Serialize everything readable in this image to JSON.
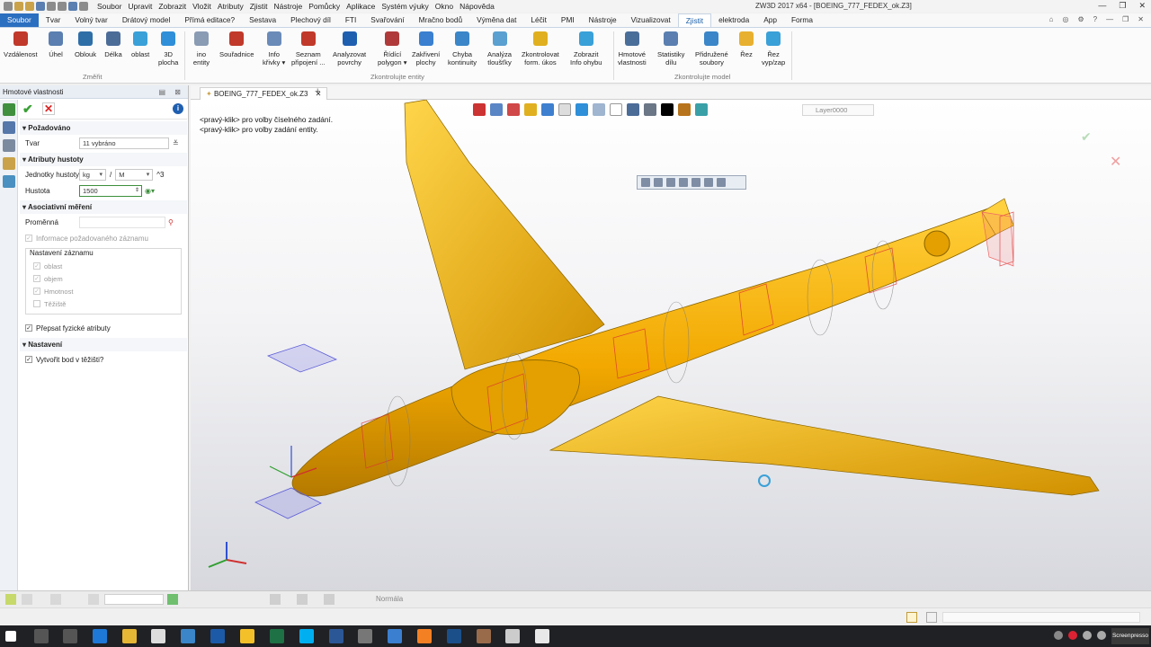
{
  "menu": [
    "Soubor",
    "Upravit",
    "Zobrazit",
    "Vložit",
    "Atributy",
    "Zjistit",
    "Nástroje",
    "Pomůcky",
    "Aplikace",
    "Systém výuky",
    "Okno",
    "Nápověda"
  ],
  "window_title": "ZW3D 2017 x64 - [BOEING_777_FEDEX_ok.Z3]",
  "ribbon_tabs": [
    "Soubor",
    "Tvar",
    "Volný tvar",
    "Drátový model",
    "Přímá editace?",
    "Sestava",
    "Plechový díl",
    "FTI",
    "Svařování",
    "Mračno bodů",
    "Výměna dat",
    "Léčit",
    "PMI",
    "Nástroje",
    "Vizualizovat",
    "Zjistit",
    "elektroda",
    "App",
    "Forma"
  ],
  "active_tab": "Zjistit",
  "ribbon": {
    "measure": [
      {
        "label": "Vzdálenost",
        "icon": "distance-icon"
      },
      {
        "label": "Úhel",
        "icon": "angle-icon"
      },
      {
        "label": "Oblouk",
        "icon": "arc-icon"
      },
      {
        "label": "Délka",
        "icon": "length-icon"
      },
      {
        "label": "oblast",
        "icon": "area-icon"
      },
      {
        "label": "3D\nplocha",
        "icon": "3d-surface-icon"
      }
    ],
    "measure_group": "Změřit",
    "check": [
      {
        "label": "ino\nentity",
        "icon": "info-entity-icon"
      },
      {
        "label": "Souřadnice",
        "icon": "coordinates-icon"
      },
      {
        "label": "Info\nkřivky ▾",
        "icon": "curve-info-icon"
      },
      {
        "label": "Seznam\npřipojení ...",
        "icon": "connection-list-icon"
      },
      {
        "label": "Analyzovat\npovrchy",
        "icon": "analyze-surface-icon"
      },
      {
        "label": "Řídící\npolygon ▾",
        "icon": "control-polygon-icon"
      },
      {
        "label": "Zakřivení\nplochy",
        "icon": "curvature-icon"
      },
      {
        "label": "Chyba\nkontinuity",
        "icon": "continuity-icon"
      },
      {
        "label": "Analýza\ntloušťky",
        "icon": "thickness-icon"
      },
      {
        "label": "Zkontrolovat\nform. úkos",
        "icon": "draft-check-icon"
      },
      {
        "label": "Zobrazit\nInfo ohybu",
        "icon": "bend-info-icon"
      }
    ],
    "check_group": "Zkontrolujte entity",
    "model": [
      {
        "label": "Hmotové\nvlastnosti",
        "icon": "mass-properties-icon"
      },
      {
        "label": "Statistiky\ndílu",
        "icon": "part-stats-icon"
      },
      {
        "label": "Přidružené\nsoubory",
        "icon": "related-files-icon"
      },
      {
        "label": "Řez",
        "icon": "section-icon"
      },
      {
        "label": "Řez\nvyp/zap",
        "icon": "section-toggle-icon"
      }
    ],
    "model_group": "Zkontrolujte model"
  },
  "panel": {
    "title": "Hmotové vlastnosti",
    "section_required": "Požadováno",
    "shape_label": "Tvar",
    "shape_value": "11 vybráno",
    "section_density": "Atributy hustoty",
    "density_units_label": "Jednotky hustoty",
    "unit_mass": "kg",
    "unit_sep": "/",
    "unit_length": "M",
    "unit_power": "^3",
    "density_label": "Hustota",
    "density_value": "1500",
    "section_assoc": "Asociativní měření",
    "variable_label": "Proměnná",
    "info_req_label": "Informace požadovaného záznamu",
    "record_settings": "Nastavení záznamu",
    "rec_items": [
      "oblast",
      "objem",
      "Hmotnost",
      "Těžiště"
    ],
    "rewrite_label": "Přepsat fyzické atributy",
    "section_settings": "Nastavení",
    "create_point_label": "Vytvořit bod v těžišti?"
  },
  "document_tab": "BOEING_777_FEDEX_ok.Z3",
  "hints": [
    "<pravý-klik> pro volby číselného zadání.",
    "<pravý-klik> pro volby zadání entity."
  ],
  "layer": "Layer0000",
  "status": {
    "mode": "Normála"
  },
  "taskbar_badge": "Screenpresso"
}
